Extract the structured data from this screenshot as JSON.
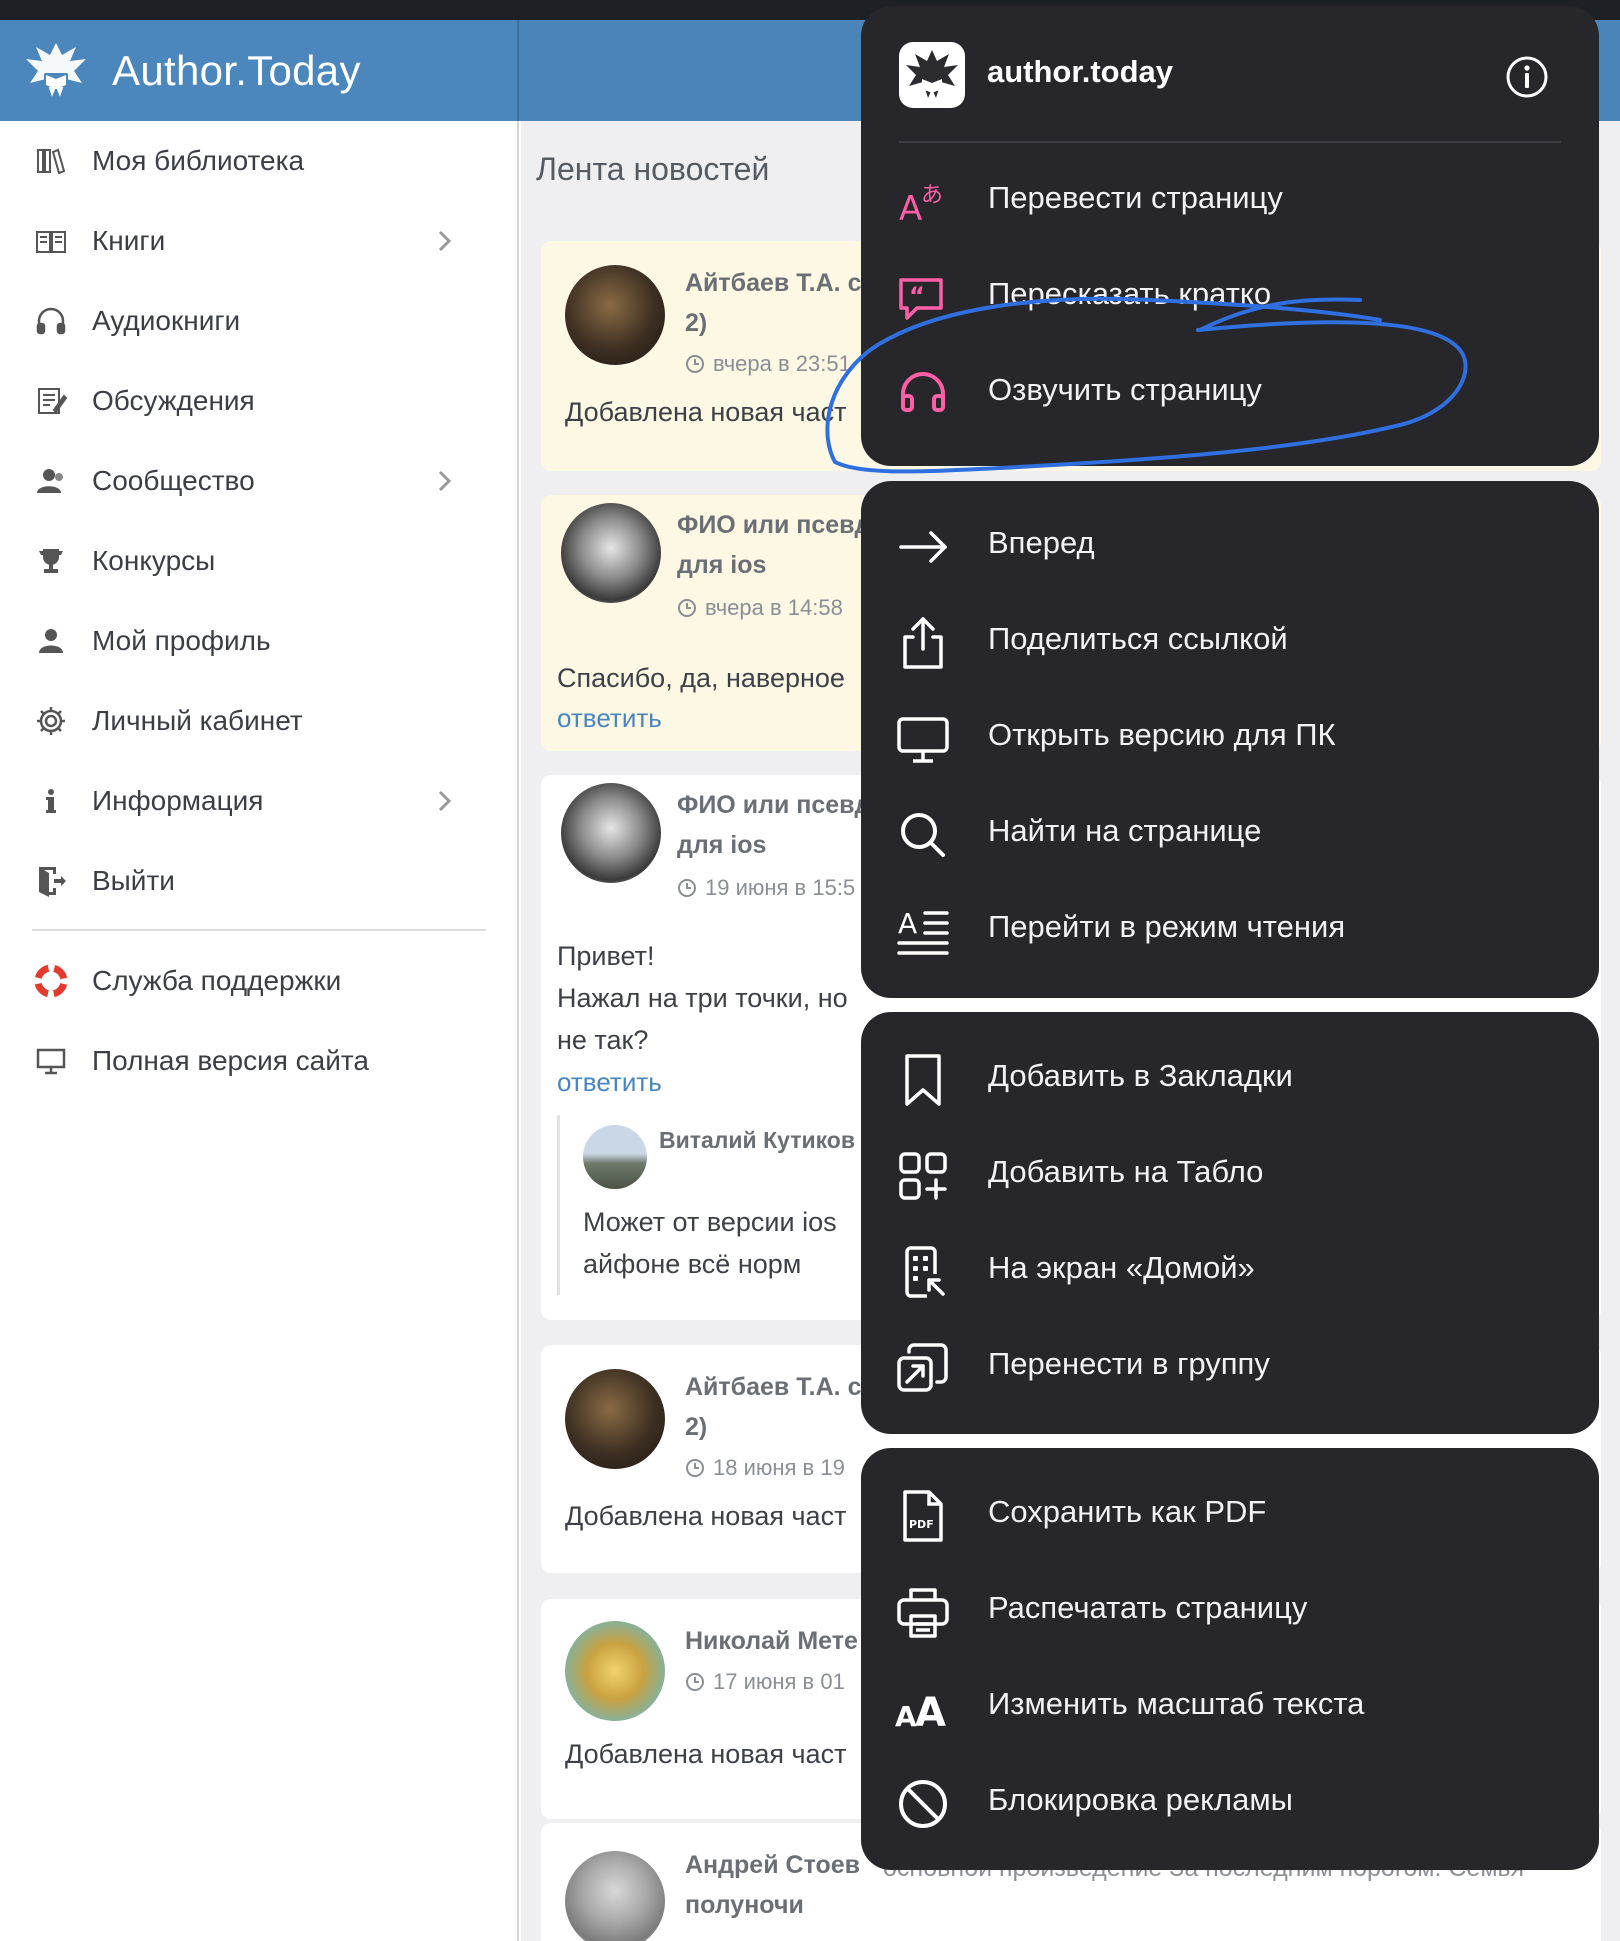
{
  "site": {
    "logo_text": "Author.Today"
  },
  "sidebar": {
    "items": [
      {
        "label": "Моя библиотека",
        "icon": "library-icon"
      },
      {
        "label": "Книги",
        "icon": "book-icon",
        "has_submenu": true
      },
      {
        "label": "Аудиокниги",
        "icon": "headphones-icon"
      },
      {
        "label": "Обсуждения",
        "icon": "discussion-icon"
      },
      {
        "label": "Сообщество",
        "icon": "community-icon",
        "has_submenu": true
      },
      {
        "label": "Конкурсы",
        "icon": "trophy-icon"
      },
      {
        "label": "Мой профиль",
        "icon": "user-icon"
      },
      {
        "label": "Личный кабинет",
        "icon": "gear-icon"
      },
      {
        "label": "Информация",
        "icon": "info-icon",
        "has_submenu": true
      },
      {
        "label": "Выйти",
        "icon": "logout-icon"
      }
    ],
    "extra": [
      {
        "label": "Служба поддержки",
        "icon": "lifebuoy-icon"
      },
      {
        "label": "Полная версия сайта",
        "icon": "monitor-icon"
      }
    ]
  },
  "feed": {
    "title": "Лента новостей",
    "cards": [
      {
        "name": "Айтбаев Т.А. с",
        "name2": "2)",
        "time": "вчера в 23:51",
        "text": "Добавлена новая част"
      },
      {
        "name": "ФИО или псевд",
        "name2": "для ios",
        "time": "вчера в 14:58",
        "text": "Спасибо, да, наверное",
        "reply": "ответить"
      },
      {
        "name": "ФИО или псевд",
        "name2": "для ios",
        "time": "19 июня в 15:5",
        "text": [
          "Привет!",
          "Нажал на три точки, но",
          "не так?"
        ],
        "reply": "ответить",
        "nested": {
          "name": "Виталий Кутиков",
          "text": [
            "Может от версии ios",
            "айфоне всё норм"
          ]
        }
      },
      {
        "name": "Айтбаев Т.А. с",
        "name2": "2)",
        "time": "18 июня в 19",
        "text": "Добавлена новая част"
      },
      {
        "name": "Николай Мете",
        "time": "17 июня в 01",
        "text": "Добавлена новая част"
      },
      {
        "name": "Андрей Стоев",
        "name_tail": "основной произведение За последним порогом. Семья",
        "name2": "полуночи"
      }
    ]
  },
  "menu": {
    "app_title": "author.today",
    "groups": [
      [
        {
          "label": "Перевести страницу",
          "icon": "translate-icon",
          "color": "#ff5fa8"
        },
        {
          "label": "Пересказать кратко",
          "icon": "summary-icon",
          "color": "#ff5fa8"
        },
        {
          "label": "Озвучить страницу",
          "icon": "headphones-icon",
          "color": "#ff5fa8"
        }
      ],
      [
        {
          "label": "Вперед",
          "icon": "arrow-right-icon"
        },
        {
          "label": "Поделиться ссылкой",
          "icon": "share-icon"
        },
        {
          "label": "Открыть версию для ПК",
          "icon": "desktop-icon"
        },
        {
          "label": "Найти на странице",
          "icon": "search-icon"
        },
        {
          "label": "Перейти в режим чтения",
          "icon": "reader-mode-icon"
        }
      ],
      [
        {
          "label": "Добавить в Закладки",
          "icon": "bookmark-icon"
        },
        {
          "label": "Добавить на Табло",
          "icon": "tiles-add-icon"
        },
        {
          "label": "На экран «Домой»",
          "icon": "home-screen-icon"
        },
        {
          "label": "Перенести в группу",
          "icon": "move-group-icon"
        }
      ],
      [
        {
          "label": "Сохранить как PDF",
          "icon": "pdf-icon",
          "icon_text": "PDF"
        },
        {
          "label": "Распечатать страницу",
          "icon": "print-icon"
        },
        {
          "label": "Изменить масштаб текста",
          "icon": "text-size-icon",
          "icon_text": "AA"
        },
        {
          "label": "Блокировка рекламы",
          "icon": "block-ads-icon"
        }
      ]
    ]
  },
  "colors": {
    "header_blue": "#4a84b9",
    "menu_bg": "#26262b",
    "accent_pink": "#ff5fa8",
    "reply_link": "#4a86bd",
    "scribble_blue": "#2f6fe0"
  }
}
